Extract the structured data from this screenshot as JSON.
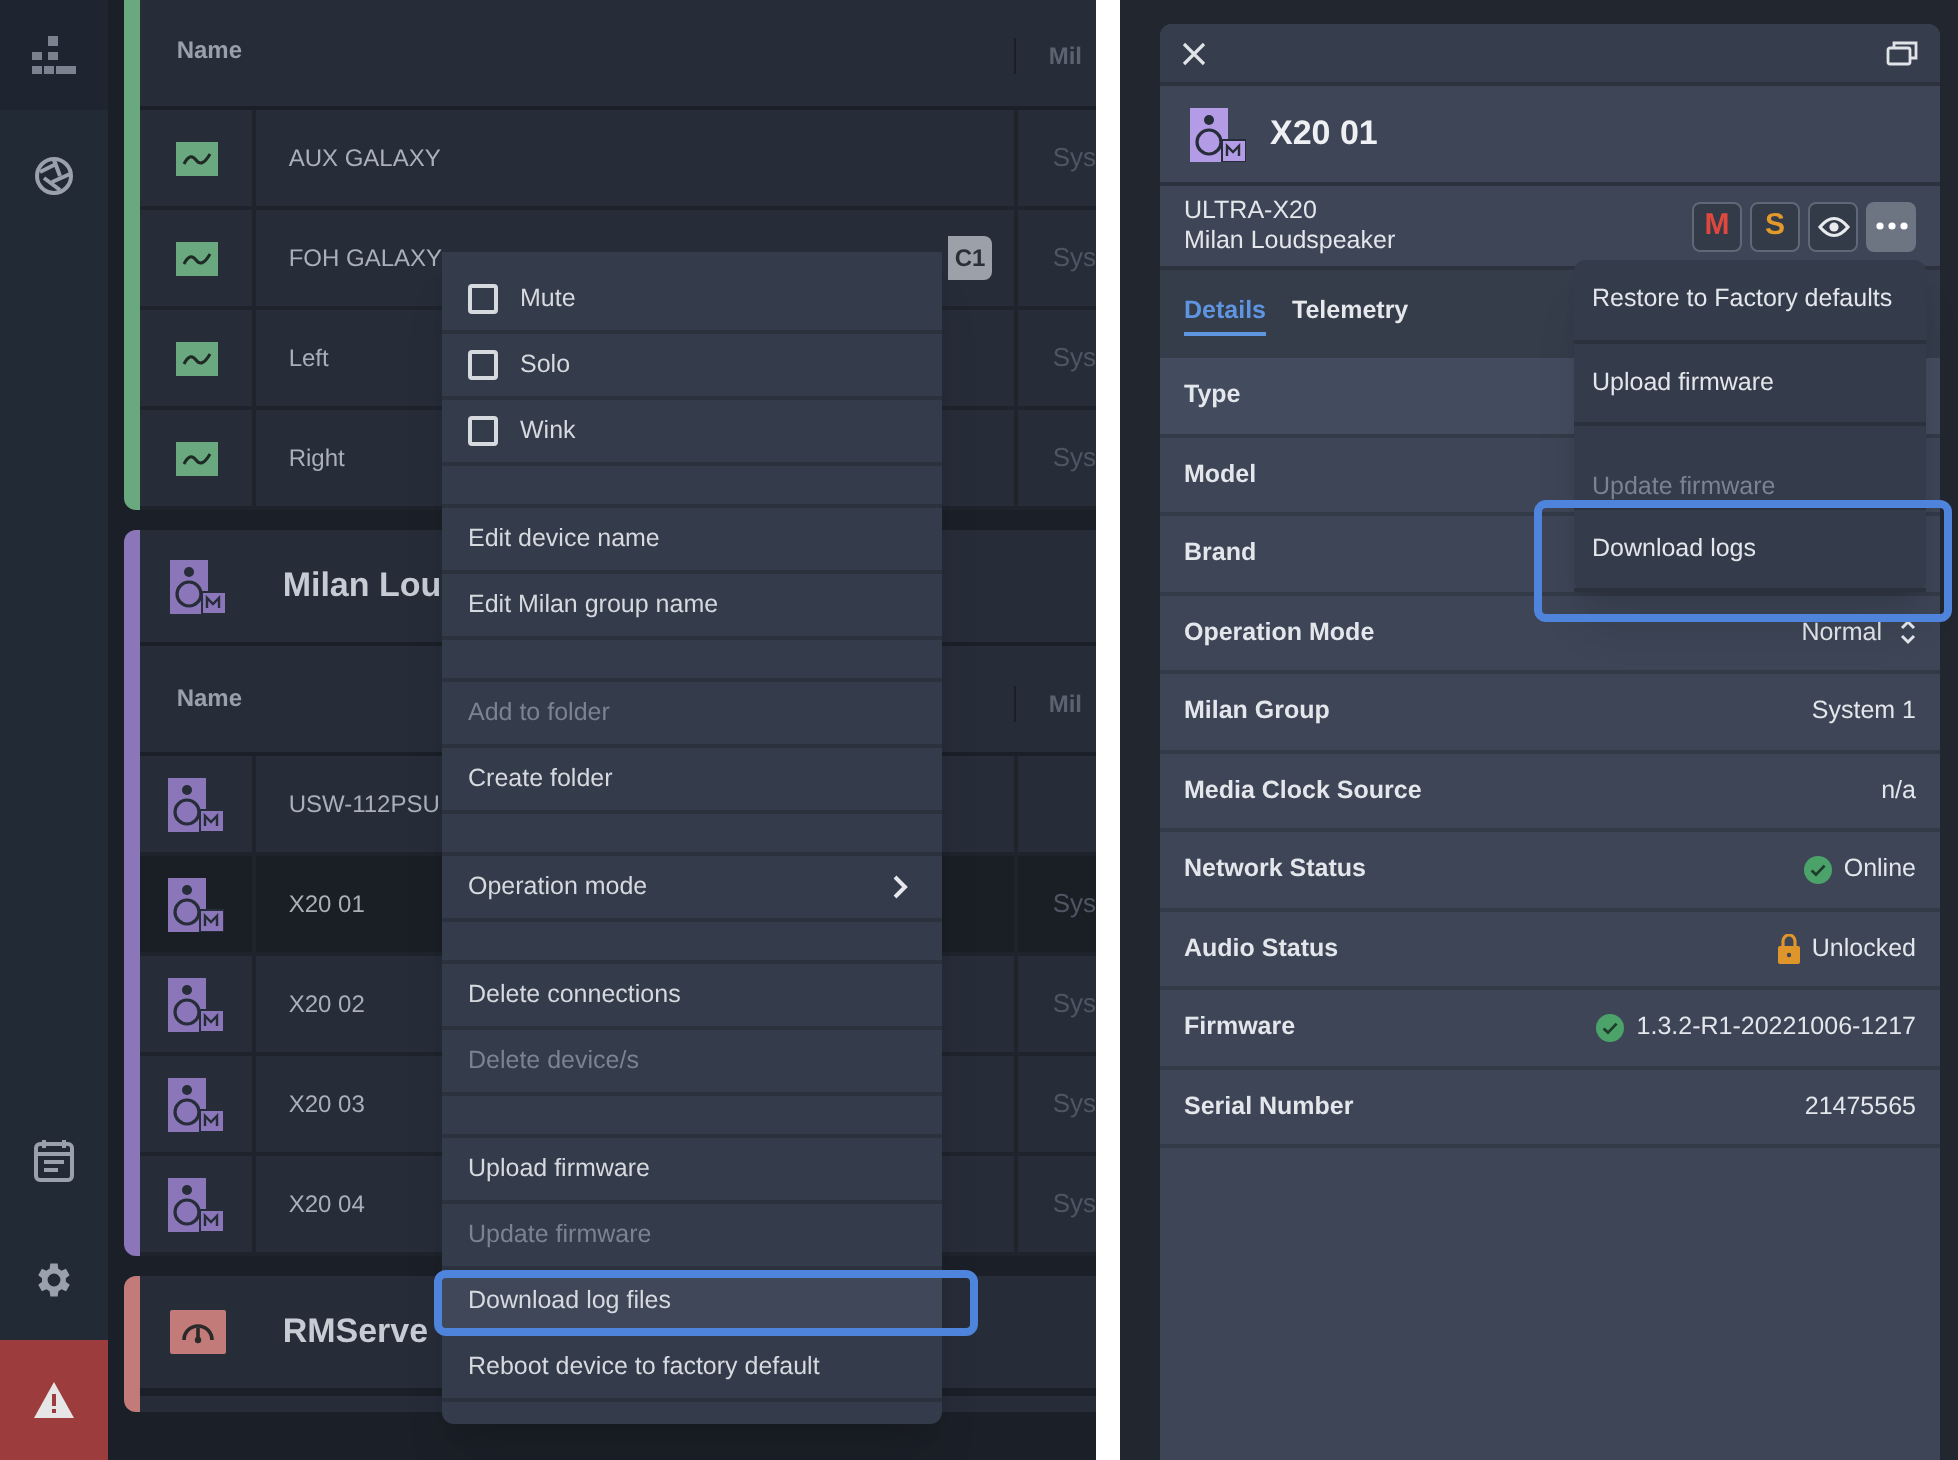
{
  "device_list": {
    "groups": [
      {
        "kind": "processor",
        "color": "#6aa880",
        "columns": [
          "Name",
          "Mil"
        ],
        "rows": [
          {
            "name": "AUX GALAXY",
            "badge": "",
            "column_3": "Sys",
            "selected": false
          },
          {
            "name": "FOH GALAXY",
            "badge": "C1",
            "column_3": "Sys",
            "selected": false
          },
          {
            "name": "Left",
            "badge": "",
            "column_3": "Sys",
            "selected": false
          },
          {
            "name": "Right",
            "badge": "",
            "column_3": "Sys",
            "selected": false
          }
        ]
      },
      {
        "kind": "speaker",
        "color": "#8a76b8",
        "title": "Milan Lou",
        "columns": [
          "Name",
          "Mil"
        ],
        "rows": [
          {
            "name": "USW-112PSU",
            "badge": "",
            "column_3": "",
            "selected": false
          },
          {
            "name": "X20 01",
            "badge": "",
            "column_3": "Sys",
            "selected": true
          },
          {
            "name": "X20 02",
            "badge": "",
            "column_3": "Sys",
            "selected": false
          },
          {
            "name": "X20 03",
            "badge": "",
            "column_3": "Sys",
            "selected": false
          },
          {
            "name": "X20 04",
            "badge": "",
            "column_3": "Sys",
            "selected": false
          }
        ]
      },
      {
        "kind": "server",
        "color": "#c27b78",
        "title": "RMServe"
      }
    ],
    "context_menu": {
      "items": [
        {
          "kind": "checkbox",
          "label": "Mute",
          "checked": false
        },
        {
          "kind": "checkbox",
          "label": "Solo",
          "checked": false
        },
        {
          "kind": "checkbox",
          "label": "Wink",
          "checked": false
        },
        {
          "kind": "spacer"
        },
        {
          "kind": "action",
          "label": "Edit device name",
          "disabled": false,
          "hovered": false
        },
        {
          "kind": "action",
          "label": "Edit Milan group name",
          "disabled": false,
          "hovered": false
        },
        {
          "kind": "spacer"
        },
        {
          "kind": "action",
          "label": "Add to folder",
          "disabled": true,
          "hovered": false
        },
        {
          "kind": "action",
          "label": "Create folder",
          "disabled": false,
          "hovered": false
        },
        {
          "kind": "spacer"
        },
        {
          "kind": "submenu",
          "label": "Operation mode",
          "disabled": false,
          "hovered": false
        },
        {
          "kind": "spacer"
        },
        {
          "kind": "action",
          "label": "Delete connections",
          "disabled": false,
          "hovered": false
        },
        {
          "kind": "action",
          "label": "Delete device/s",
          "disabled": true,
          "hovered": false
        },
        {
          "kind": "spacer"
        },
        {
          "kind": "action",
          "label": "Upload firmware",
          "disabled": false,
          "hovered": false
        },
        {
          "kind": "action",
          "label": "Update firmware",
          "disabled": true,
          "hovered": false
        },
        {
          "kind": "action",
          "label": "Download log files",
          "disabled": false,
          "hovered": true
        },
        {
          "kind": "action",
          "label": "Reboot device to factory default",
          "disabled": false,
          "hovered": false
        }
      ]
    }
  },
  "device_panel": {
    "title": "X20 01",
    "model": "ULTRA-X20",
    "description": "Milan Loudspeaker",
    "buttons": [
      {
        "kind": "mute",
        "label": "M",
        "selected": false
      },
      {
        "kind": "solo",
        "label": "S",
        "selected": false
      },
      {
        "kind": "identify",
        "selected": false
      },
      {
        "kind": "more",
        "selected": true
      }
    ],
    "tabs": [
      {
        "label": "Details",
        "selected": true
      },
      {
        "label": "Telemetry",
        "selected": false
      }
    ],
    "properties": [
      {
        "label": "Type",
        "kind": "plain"
      },
      {
        "label": "Model",
        "kind": "plain"
      },
      {
        "label": "Brand",
        "kind": "plain"
      },
      {
        "label": "Operation Mode",
        "value": "Normal",
        "kind": "select"
      },
      {
        "label": "Milan Group",
        "value": "System 1",
        "kind": "plain"
      },
      {
        "label": "Media Clock Source",
        "value": "n/a",
        "kind": "plain"
      },
      {
        "label": "Network Status",
        "value": "Online",
        "kind": "ok"
      },
      {
        "label": "Audio Status",
        "value": "Unlocked",
        "kind": "unlocked"
      },
      {
        "label": "Firmware",
        "value": "1.3.2-R1-20221006-1217",
        "kind": "ok"
      },
      {
        "label": "Serial Number",
        "value": "21475565",
        "kind": "plain"
      }
    ],
    "menu": {
      "items": [
        {
          "label": "Restore to Factory defaults",
          "disabled": false
        },
        {
          "label": "Upload firmware",
          "disabled": false
        },
        {
          "label": "Update firmware",
          "disabled": true
        },
        {
          "label": "Download logs",
          "disabled": false
        }
      ]
    }
  }
}
